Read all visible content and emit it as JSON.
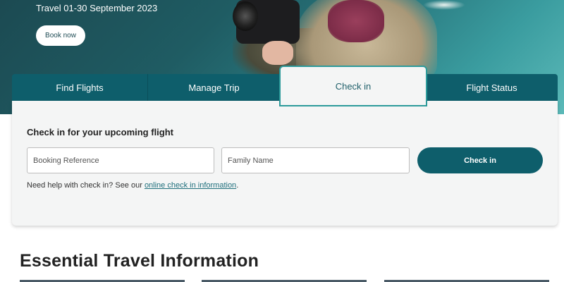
{
  "hero": {
    "subtitle": "Travel 01-30 September 2023",
    "book_now_label": "Book now"
  },
  "tabs": [
    {
      "label": "Find Flights"
    },
    {
      "label": "Manage Trip"
    },
    {
      "label": "Check in",
      "active": true
    },
    {
      "label": "Flight Status"
    }
  ],
  "checkin": {
    "title": "Check in for your upcoming flight",
    "booking_placeholder": "Booking Reference",
    "family_placeholder": "Family Name",
    "button_label": "Check in",
    "help_prefix": "Need help with check in? See our ",
    "help_link": "online check in information",
    "help_suffix": "."
  },
  "essential": {
    "title": "Essential Travel Information"
  },
  "colors": {
    "primary": "#0e5e6b",
    "active_tab_border": "#2c9a9a",
    "panel_bg": "#f4f5f5"
  }
}
